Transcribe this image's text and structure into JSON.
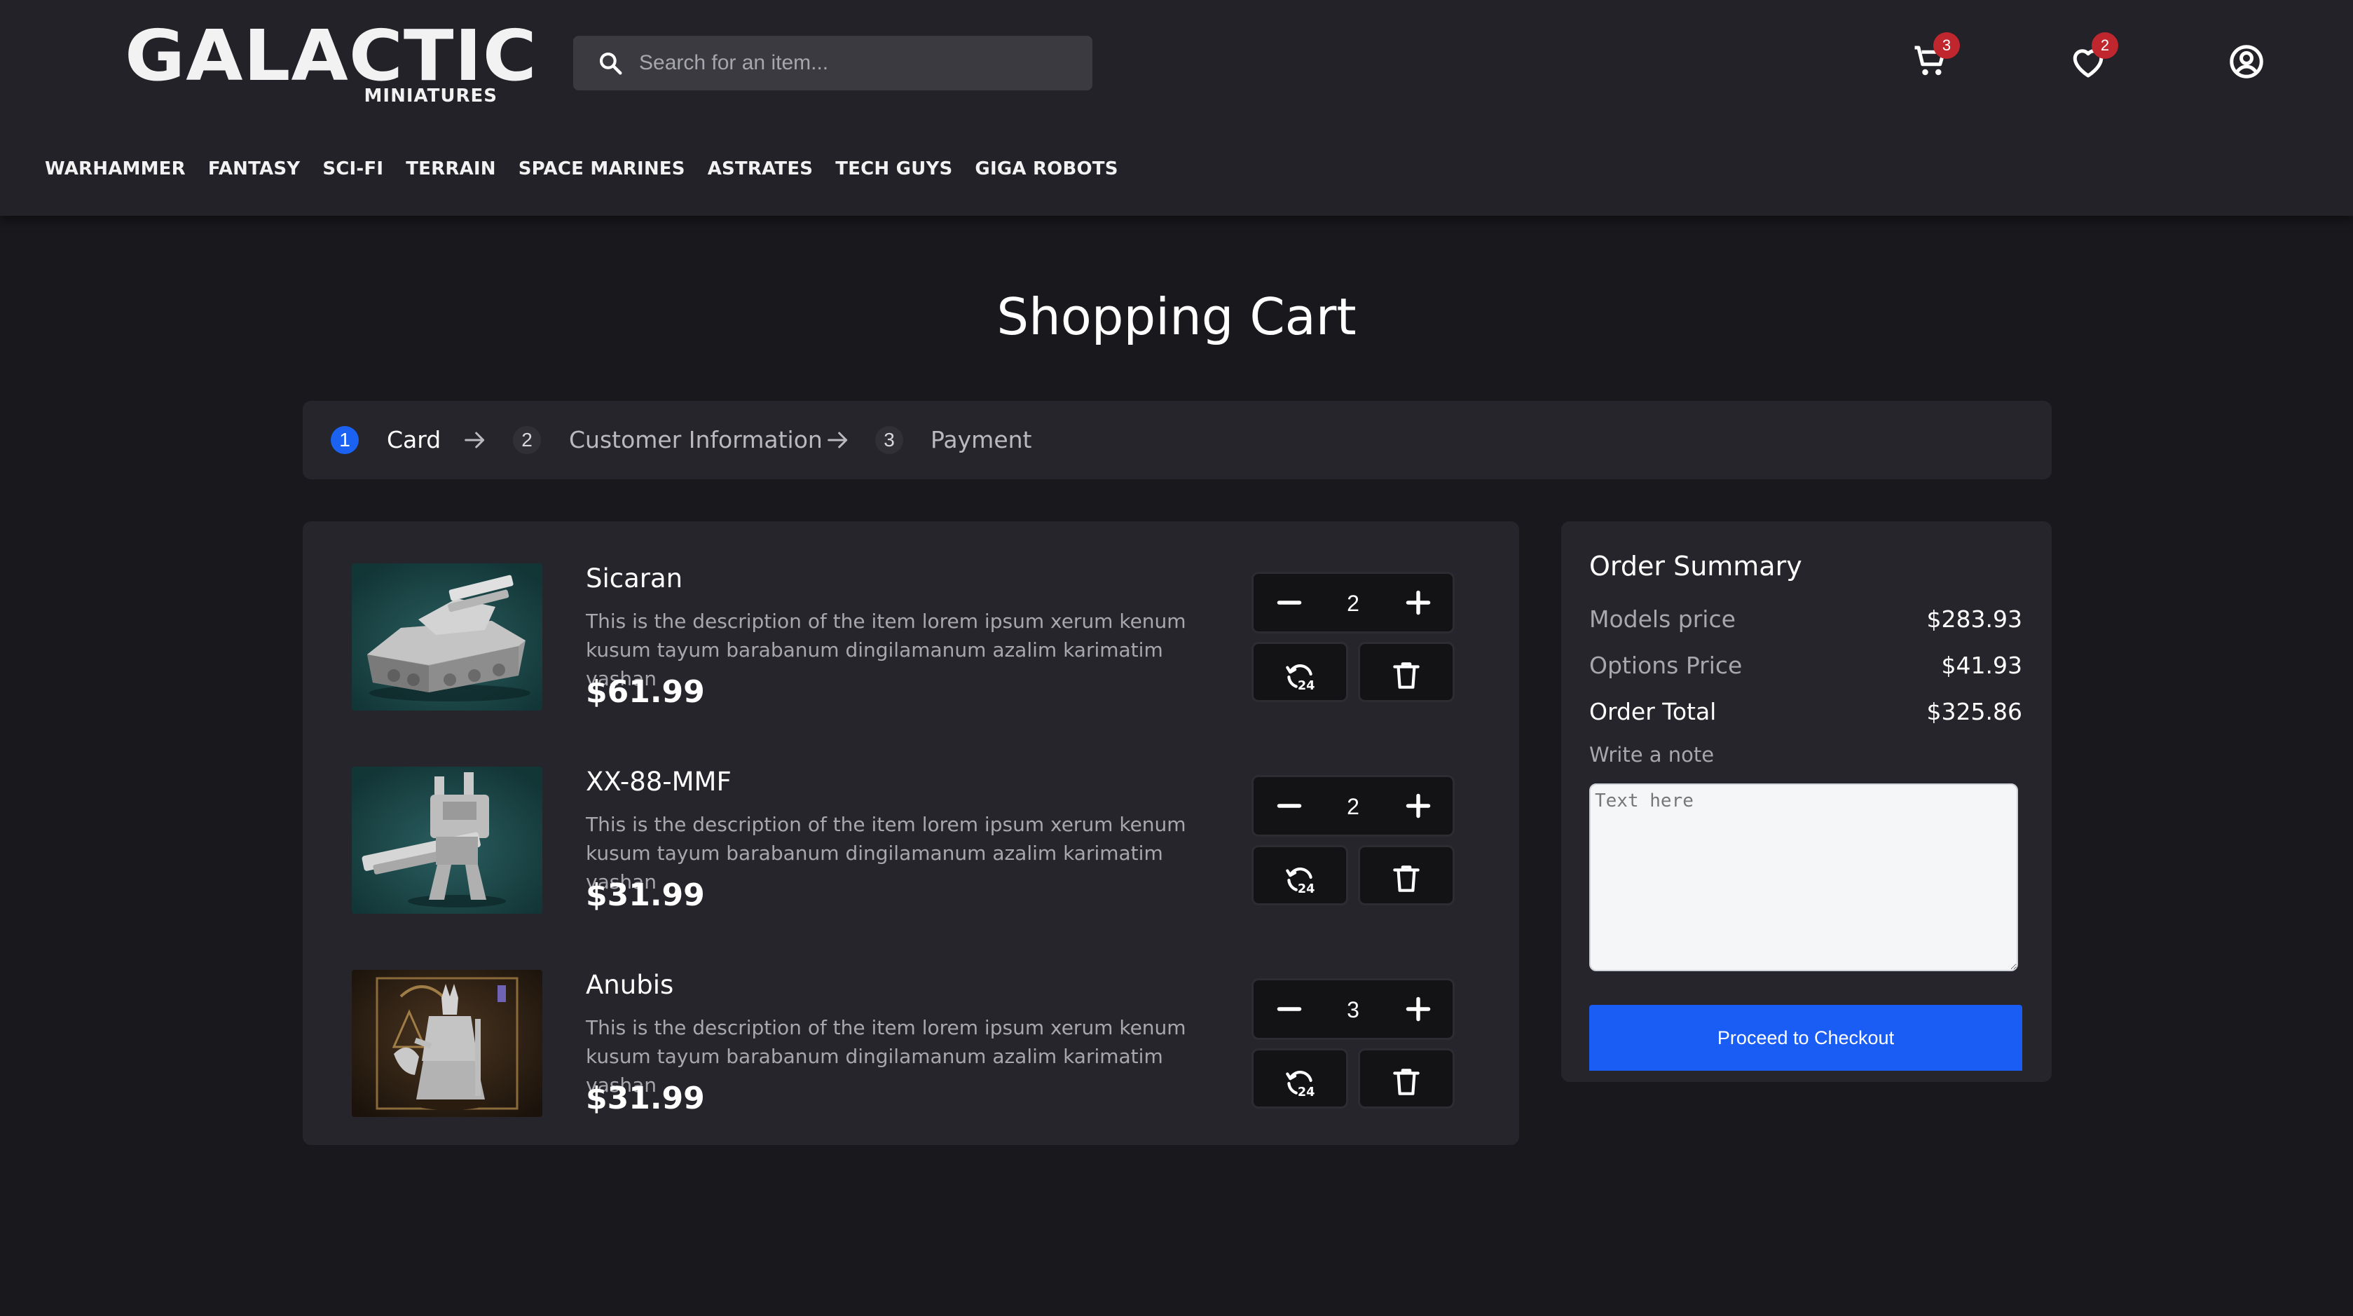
{
  "brand": {
    "name": "GALACTIC",
    "subtitle": "MINIATURES"
  },
  "search": {
    "placeholder": "Search for an item..."
  },
  "header_icons": {
    "cart_count": "3",
    "wishlist_count": "2"
  },
  "nav": {
    "items": [
      "WARHAMMER",
      "FANTASY",
      "SCI-FI",
      "TERRAIN",
      "SPACE MARINES",
      "ASTRATES",
      "TECH GUYS",
      "GIGA ROBOTS"
    ]
  },
  "page": {
    "title": "Shopping Cart"
  },
  "stepper": {
    "steps": [
      {
        "number": "1",
        "label": "Card",
        "active": true
      },
      {
        "number": "2",
        "label": "Customer Information",
        "active": false
      },
      {
        "number": "3",
        "label": "Payment",
        "active": false
      }
    ]
  },
  "cart": {
    "items": [
      {
        "name": "Sicaran",
        "description_line1": "This is the description of the item lorem ipsum xerum kenum",
        "description_line2": "kusum tayum barabanum dingilamanum azalim karimatim vashan",
        "price": "$61.99",
        "quantity": "2",
        "image": "tank-miniature"
      },
      {
        "name": "XX-88-MMF",
        "description_line1": "This is the description of the item lorem ipsum xerum kenum",
        "description_line2": "kusum tayum barabanum dingilamanum azalim karimatim vashan",
        "price": "$31.99",
        "quantity": "2",
        "image": "mech-robot-miniature"
      },
      {
        "name": "Anubis",
        "description_line1": "This is the description of the item lorem ipsum xerum kenum",
        "description_line2": "kusum tayum barabanum dingilamanum azalim karimatim vashan",
        "price": "$31.99",
        "quantity": "3",
        "image": "anubis-warrior-miniature"
      }
    ],
    "icons": {
      "decrement": "minus-icon",
      "increment": "plus-icon",
      "renew": "restore-24h-icon",
      "delete": "trash-icon"
    }
  },
  "summary": {
    "title": "Order Summary",
    "rows": [
      {
        "label": "Models price",
        "value": "$283.93"
      },
      {
        "label": "Options Price",
        "value": "$41.93"
      },
      {
        "label": "Order Total",
        "value": "$325.86"
      }
    ],
    "note_label": "Write a note",
    "note_placeholder": "Text here",
    "checkout_label": "Proceed to Checkout"
  },
  "colors": {
    "background": "#19191d",
    "header": "#222228",
    "panel": "#25252b",
    "accent": "#1a5df4",
    "badge": "#c0262d"
  }
}
